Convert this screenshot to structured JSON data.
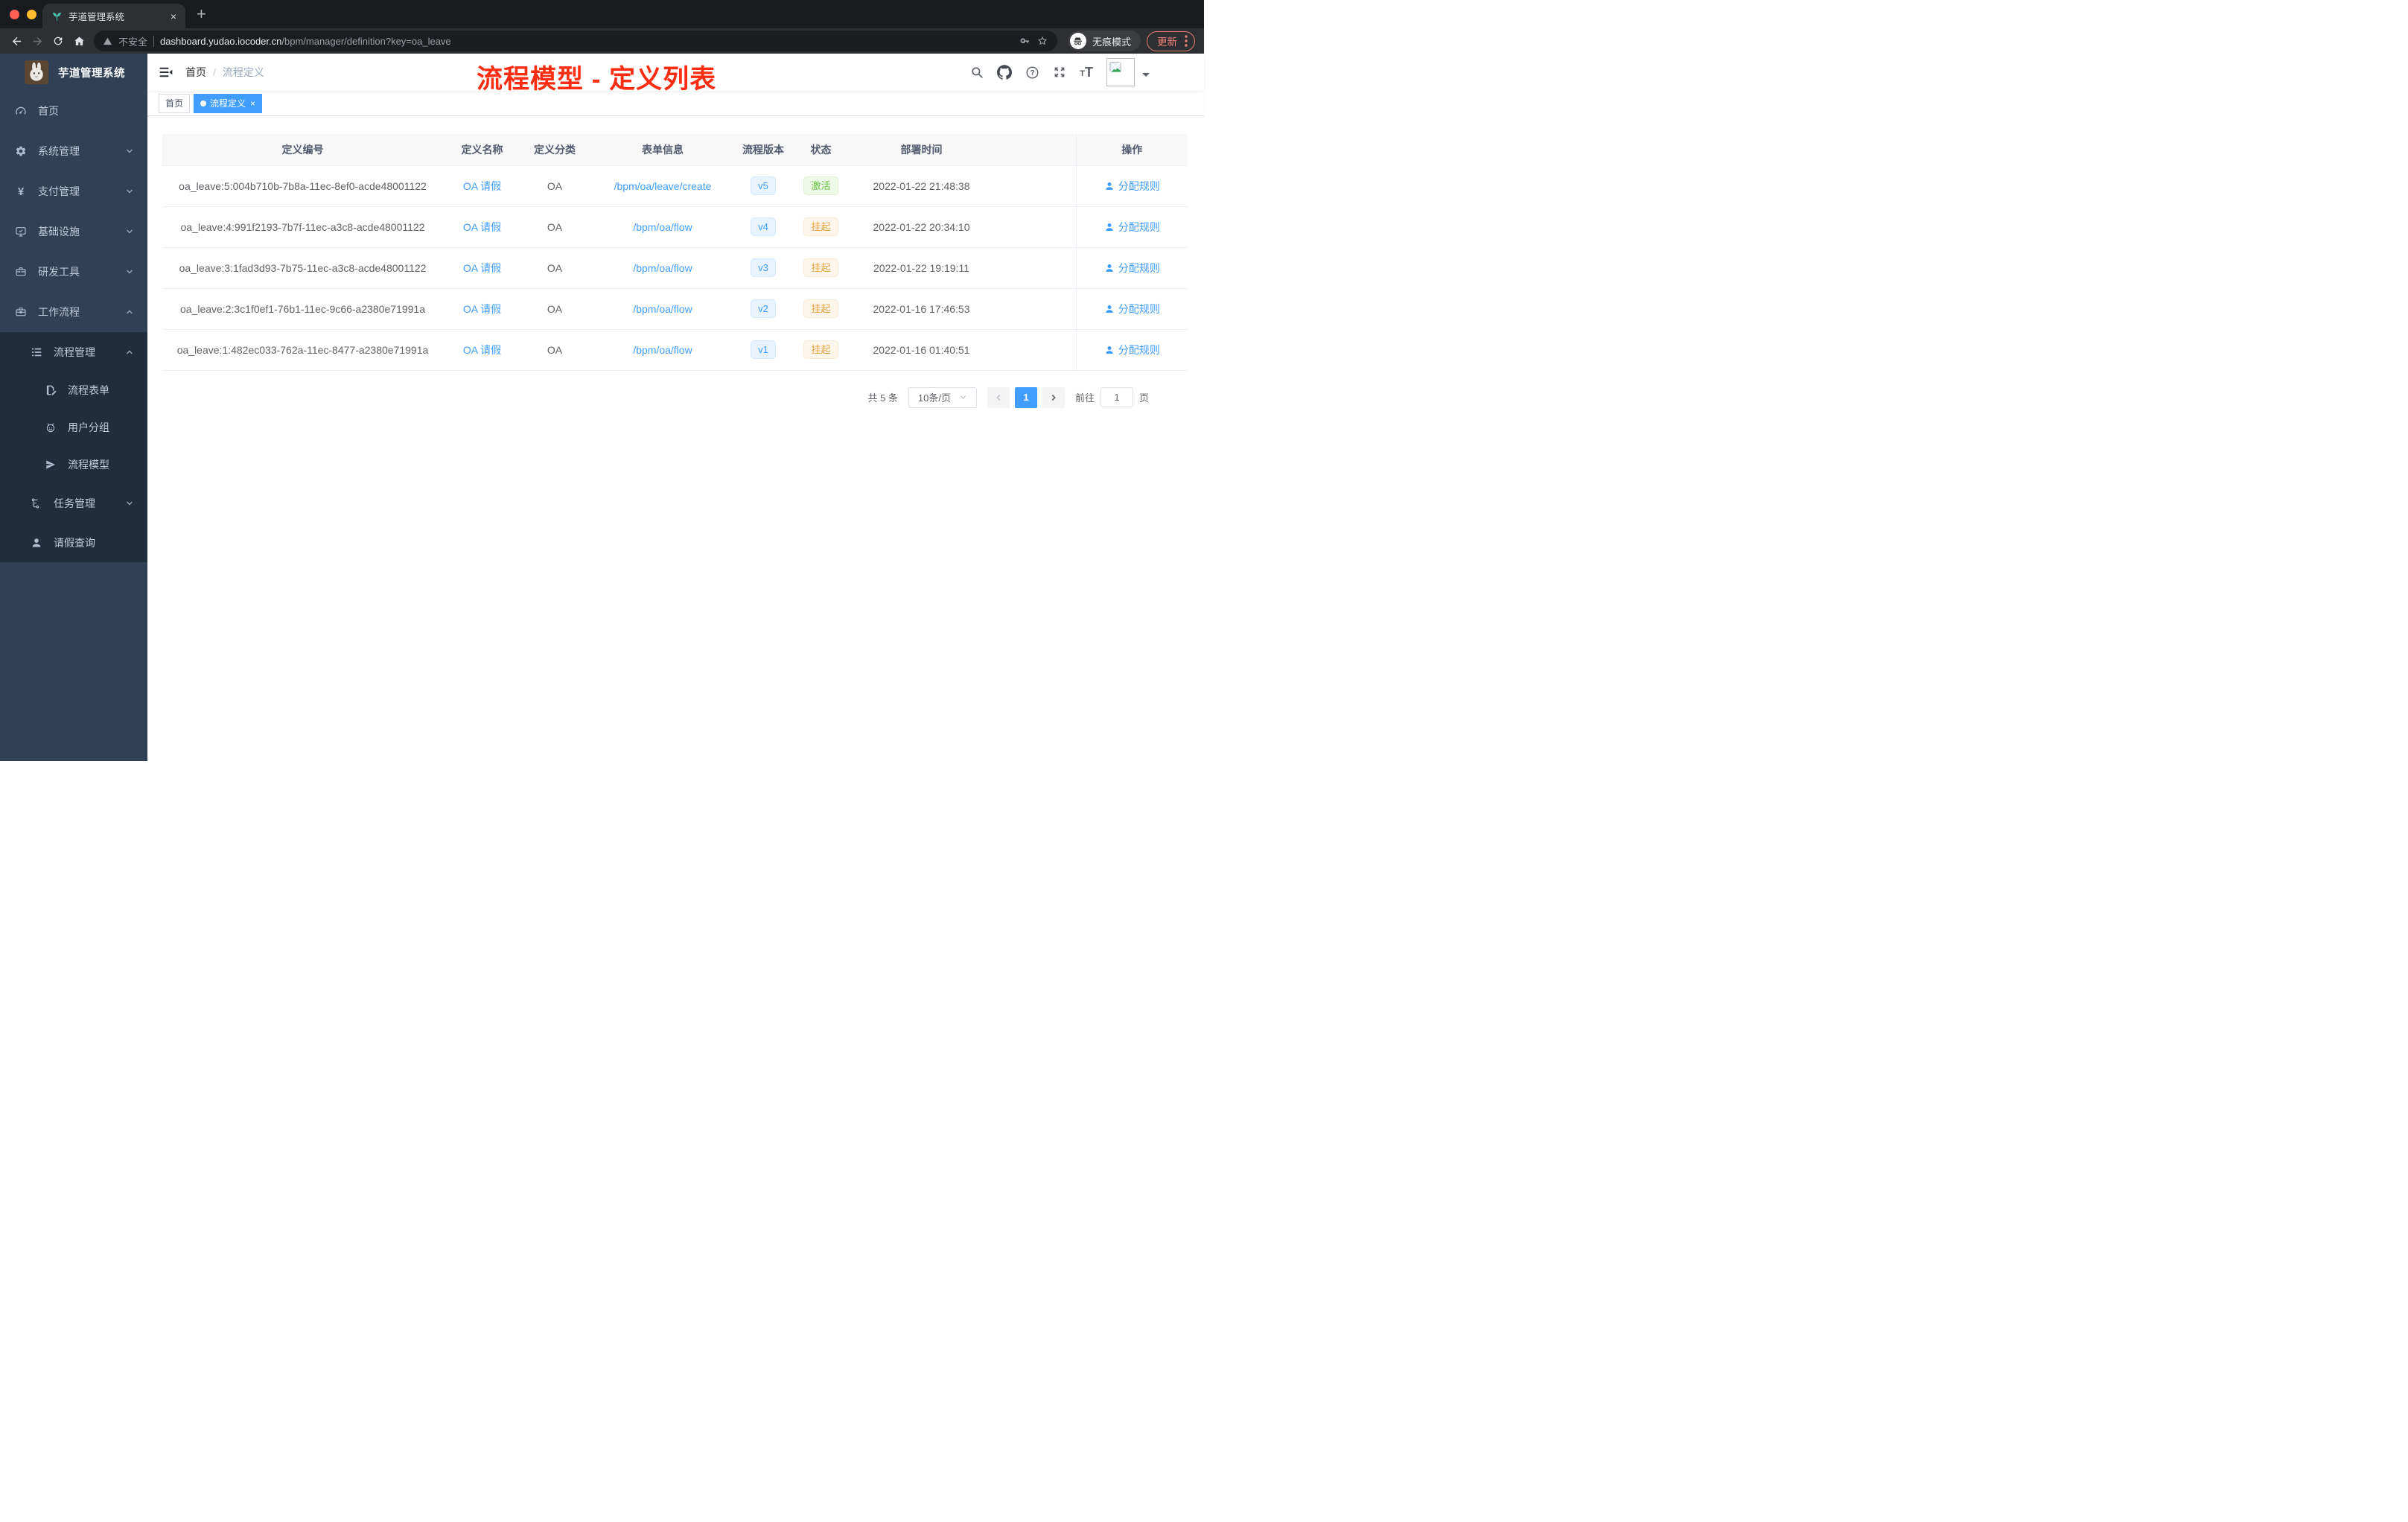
{
  "browser": {
    "tab_title": "芋道管理系统",
    "close_tab": "×",
    "new_tab": "+",
    "security_label": "不安全",
    "url_domain": "dashboard.yudao.iocoder.cn",
    "url_path": "/bpm/manager/definition?key=oa_leave",
    "incognito_label": "无痕模式",
    "update_label": "更新"
  },
  "sidebar": {
    "logo_title": "芋道管理系统",
    "items": [
      {
        "label": "首页",
        "icon": "dashboard-icon",
        "level": 1,
        "arrow": "",
        "submenu": false
      },
      {
        "label": "系统管理",
        "icon": "gear-icon",
        "level": 1,
        "arrow": "down",
        "submenu": false
      },
      {
        "label": "支付管理",
        "icon": "yen-icon",
        "level": 1,
        "arrow": "down",
        "submenu": false
      },
      {
        "label": "基础设施",
        "icon": "monitor-icon",
        "level": 1,
        "arrow": "down",
        "submenu": false
      },
      {
        "label": "研发工具",
        "icon": "toolbox-icon",
        "level": 1,
        "arrow": "down",
        "submenu": false
      },
      {
        "label": "工作流程",
        "icon": "briefcase-icon",
        "level": 1,
        "arrow": "up",
        "submenu": false
      },
      {
        "label": "流程管理",
        "icon": "list-icon",
        "level": 2,
        "arrow": "up",
        "submenu": true
      },
      {
        "label": "流程表单",
        "icon": "form-icon",
        "level": 3,
        "arrow": "",
        "submenu": true
      },
      {
        "label": "用户分组",
        "icon": "user-group-icon",
        "level": 3,
        "arrow": "",
        "submenu": true
      },
      {
        "label": "流程模型",
        "icon": "paper-plane-icon",
        "level": 3,
        "arrow": "",
        "submenu": true
      },
      {
        "label": "任务管理",
        "icon": "tree-icon",
        "level": 2,
        "arrow": "down",
        "submenu": true
      },
      {
        "label": "请假查询",
        "icon": "person-icon",
        "level": 2,
        "arrow": "",
        "submenu": true
      }
    ]
  },
  "navbar": {
    "breadcrumb_home": "首页",
    "breadcrumb_separator": "/",
    "breadcrumb_current": "流程定义"
  },
  "annotation": {
    "text": "流程模型 - 定义列表",
    "color": "#fe2c10"
  },
  "tags": [
    {
      "label": "首页",
      "active": false,
      "closable": false
    },
    {
      "label": "流程定义",
      "active": true,
      "closable": true
    }
  ],
  "table": {
    "columns": [
      "定义编号",
      "定义名称",
      "定义分类",
      "表单信息",
      "流程版本",
      "状态",
      "部署时间",
      "操作"
    ],
    "action_label": "分配规则",
    "rows": [
      {
        "id": "oa_leave:5:004b710b-7b8a-11ec-8ef0-acde48001122",
        "name": "OA 请假",
        "category": "OA",
        "form": "/bpm/oa/leave/create",
        "version": "v5",
        "status": "激活",
        "status_type": "success",
        "deployed_at": "2022-01-22 21:48:38"
      },
      {
        "id": "oa_leave:4:991f2193-7b7f-11ec-a3c8-acde48001122",
        "name": "OA 请假",
        "category": "OA",
        "form": "/bpm/oa/flow",
        "version": "v4",
        "status": "挂起",
        "status_type": "warning",
        "deployed_at": "2022-01-22 20:34:10"
      },
      {
        "id": "oa_leave:3:1fad3d93-7b75-11ec-a3c8-acde48001122",
        "name": "OA 请假",
        "category": "OA",
        "form": "/bpm/oa/flow",
        "version": "v3",
        "status": "挂起",
        "status_type": "warning",
        "deployed_at": "2022-01-22 19:19:11"
      },
      {
        "id": "oa_leave:2:3c1f0ef1-76b1-11ec-9c66-a2380e71991a",
        "name": "OA 请假",
        "category": "OA",
        "form": "/bpm/oa/flow",
        "version": "v2",
        "status": "挂起",
        "status_type": "warning",
        "deployed_at": "2022-01-16 17:46:53"
      },
      {
        "id": "oa_leave:1:482ec033-762a-11ec-8477-a2380e71991a",
        "name": "OA 请假",
        "category": "OA",
        "form": "/bpm/oa/flow",
        "version": "v1",
        "status": "挂起",
        "status_type": "warning",
        "deployed_at": "2022-01-16 01:40:51"
      }
    ]
  },
  "pagination": {
    "total_label": "共 5 条",
    "page_size_label": "10条/页",
    "current_page": "1",
    "goto_label": "前往",
    "goto_value": "1",
    "goto_unit": "页"
  },
  "colors": {
    "primary": "#409eff",
    "success": "#67c23a",
    "warning": "#e6a23c",
    "annotation_red": "#fe2c10",
    "sidebar_bg": "#304156",
    "submenu_bg": "#1f2d3d",
    "active_tag_bg": "#409eff"
  }
}
